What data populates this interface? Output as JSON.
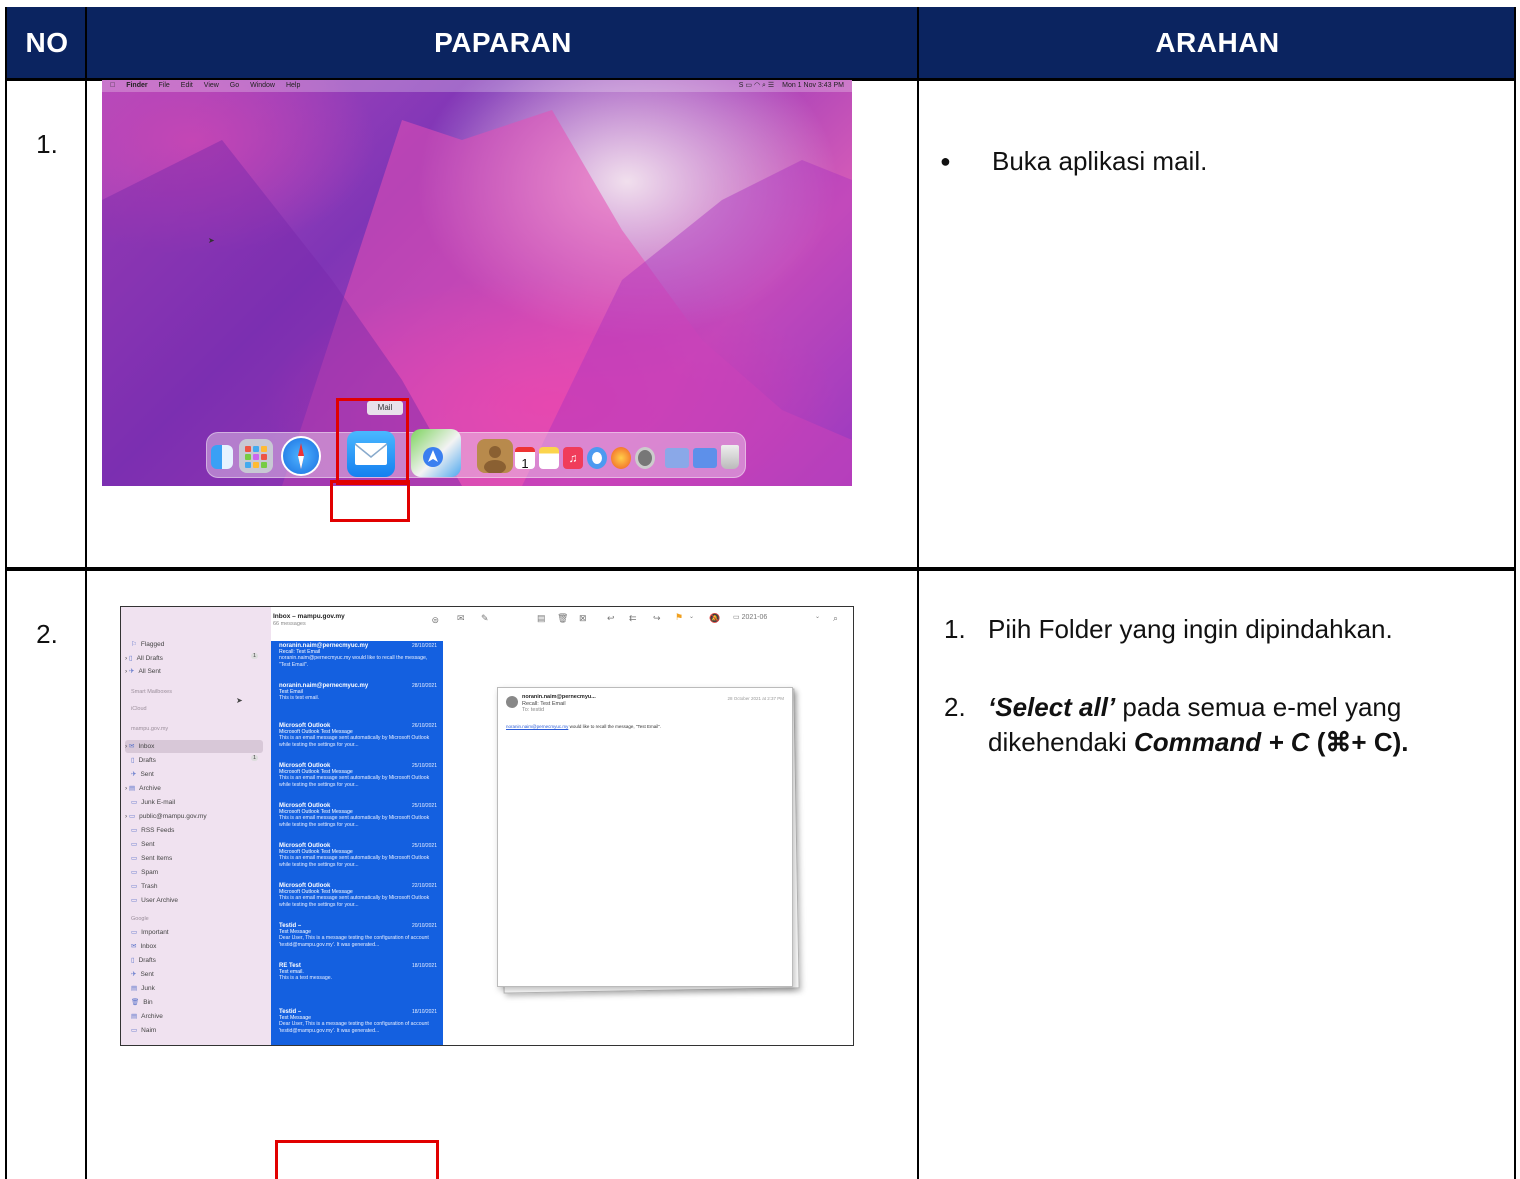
{
  "header": {
    "col_no": "NO",
    "col_paparan": "PAPARAN",
    "col_arahan": "ARAHAN"
  },
  "colors": {
    "header_bg": "#0b2460",
    "highlight_box": "#e10000",
    "mail_selection": "#1460e0"
  },
  "row1": {
    "no": "1.",
    "desktop": {
      "menubar_app": "Finder",
      "menubar_items": [
        "File",
        "Edit",
        "View",
        "Go",
        "Window",
        "Help"
      ],
      "menubar_clock": "Mon 1 Nov 3:43 PM",
      "dock_tooltip": "Mail",
      "calendar_date": "1"
    },
    "instruction": "Buka aplikasi mail."
  },
  "row2": {
    "no": "2.",
    "mail": {
      "mailbox_title": "Inbox – mampu.gov.my",
      "message_count": "66 messages",
      "folder_chip": "2021-06",
      "sidebar": {
        "flagged": "Flagged",
        "all_drafts": "All Drafts",
        "all_drafts_count": "1",
        "all_sent": "All Sent",
        "smart_mailboxes": "Smart Mailboxes",
        "icloud": "iCloud",
        "account1": "mampu.gov.my",
        "inbox": "Inbox",
        "drafts": "Drafts",
        "drafts_count": "1",
        "sent": "Sent",
        "archive": "Archive",
        "junk_email": "Junk E-mail",
        "public": "public@mampu.gov.my",
        "rss": "RSS Feeds",
        "sent2": "Sent",
        "sent_items": "Sent Items",
        "spam": "Spam",
        "trash": "Trash",
        "user_archive": "User Archive",
        "google": "Google",
        "important": "Important",
        "g_inbox": "Inbox",
        "g_drafts": "Drafts",
        "g_sent": "Sent",
        "g_junk": "Junk",
        "g_bin": "Bin",
        "g_archive": "Archive",
        "g_naim": "Naim"
      },
      "messages": [
        {
          "from": "noranin.naim@pernecmyuc.my",
          "date": "28/10/2021",
          "subject": "Recall: Test Email",
          "preview": "noranin.naim@pernecmyuc.my would like to recall the message, \"Test Email\"."
        },
        {
          "from": "noranin.naim@pernecmyuc.my",
          "date": "28/10/2021",
          "subject": "Test Email",
          "preview": "This is test email."
        },
        {
          "from": "Microsoft Outlook",
          "date": "26/10/2021",
          "subject": "Microsoft Outlook Test Message",
          "preview": "This is an email message sent automatically by Microsoft Outlook while testing the settings for your..."
        },
        {
          "from": "Microsoft Outlook",
          "date": "25/10/2021",
          "subject": "Microsoft Outlook Test Message",
          "preview": "This is an email message sent automatically by Microsoft Outlook while testing the settings for your..."
        },
        {
          "from": "Microsoft Outlook",
          "date": "25/10/2021",
          "subject": "Microsoft Outlook Test Message",
          "preview": "This is an email message sent automatically by Microsoft Outlook while testing the settings for your..."
        },
        {
          "from": "Microsoft Outlook",
          "date": "25/10/2021",
          "subject": "Microsoft Outlook Test Message",
          "preview": "This is an email message sent automatically by Microsoft Outlook while testing the settings for your..."
        },
        {
          "from": "Microsoft Outlook",
          "date": "22/10/2021",
          "subject": "Microsoft Outlook Test Message",
          "preview": "This is an email message sent automatically by Microsoft Outlook while testing the settings for your..."
        },
        {
          "from": "Testid –",
          "date": "20/10/2021",
          "subject": "Test Message",
          "preview": "Dear User, This is a message testing the configuration of account 'testid@mampu.gov.my'. It was generated..."
        },
        {
          "from": "RE Test",
          "date": "18/10/2021",
          "subject": "Test email.",
          "preview": "This is a test message."
        },
        {
          "from": "Testid –",
          "date": "18/10/2021",
          "subject": "Test Message",
          "preview": "Dear User, This is a message testing the configuration of account 'testid@mampu.gov.my'. It was generated..."
        }
      ],
      "reader": {
        "from": "noranin.naim@pernecmyu...",
        "subject": "Recall: Test Email",
        "to": "To: testid",
        "date": "28 October 2021 at 2:37 PM",
        "link": "noranin.naim@pernecmyuc.my",
        "body": " would like to recall the message, \"Test Email\"."
      }
    },
    "instructions": {
      "step1_num": "1.",
      "step1": "Piih Folder yang ingin dipindahkan.",
      "step2_num": "2.",
      "step2_part1": "‘Select all’",
      "step2_part2": " pada semua e-mel yang dikehendaki ",
      "step2_part3": "Command + C",
      "step2_part4": "  (⌘+ C)."
    }
  }
}
